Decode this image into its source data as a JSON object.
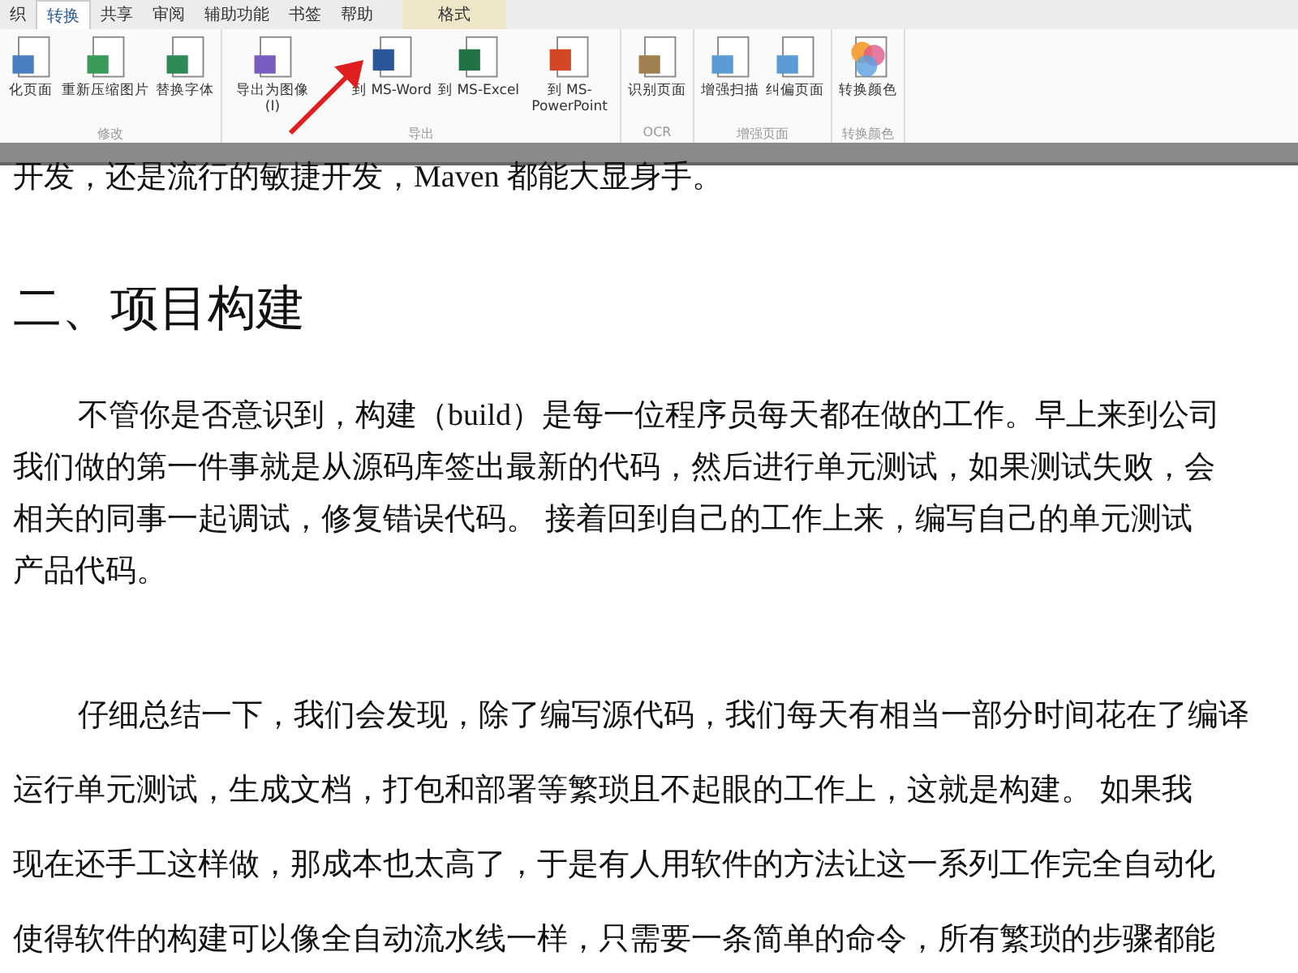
{
  "ribbon": {
    "tabs": [
      {
        "label": "织",
        "selected": false,
        "kind": "normal"
      },
      {
        "label": "转换",
        "selected": true,
        "kind": "normal"
      },
      {
        "label": "共享",
        "selected": false,
        "kind": "normal"
      },
      {
        "label": "审阅",
        "selected": false,
        "kind": "normal"
      },
      {
        "label": "辅助功能",
        "selected": false,
        "kind": "normal"
      },
      {
        "label": "书签",
        "selected": false,
        "kind": "normal"
      },
      {
        "label": "帮助",
        "selected": false,
        "kind": "normal"
      },
      {
        "label": "格式",
        "selected": false,
        "kind": "context"
      }
    ],
    "groups": [
      {
        "label": "修改",
        "commands": [
          {
            "label": "化页面",
            "kind": "optimize"
          },
          {
            "label": "重新压缩图片",
            "kind": "compress"
          },
          {
            "label": "替换字体",
            "kind": "font"
          }
        ]
      },
      {
        "label": "导出",
        "commands": [
          {
            "label": "导出为图像(I)",
            "kind": "image"
          },
          {
            "label": "到 MS-Word",
            "kind": "word"
          },
          {
            "label": "到 MS-Excel",
            "kind": "excel"
          },
          {
            "label": "到 MS-PowerPoint",
            "kind": "ppt"
          }
        ]
      },
      {
        "label": "OCR",
        "commands": [
          {
            "label": "识别页面",
            "kind": "ocr"
          }
        ]
      },
      {
        "label": "增强页面",
        "commands": [
          {
            "label": "增强扫描",
            "kind": "scan"
          },
          {
            "label": "纠偏页面",
            "kind": "deskew"
          }
        ]
      },
      {
        "label": "转换颜色",
        "commands": [
          {
            "label": "转换颜色",
            "kind": "color"
          }
        ]
      }
    ]
  },
  "document": {
    "blocks": [
      {
        "kind": "line",
        "text": "开发，还是流行的敏捷开发，Maven 都能大显身手。"
      },
      {
        "kind": "heading",
        "text": "二、项目构建"
      },
      {
        "kind": "para",
        "lines": [
          "不管你是否意识到，构建（build）是每一位程序员每天都在做的工作。早上来到公司",
          "我们做的第一件事就是从源码库签出最新的代码，然后进行单元测试，如果测试失败，会",
          "相关的同事一起调试，修复错误代码。 接着回到自己的工作上来，编写自己的单元测试",
          "产品代码。"
        ]
      },
      {
        "kind": "para_loose",
        "lines": [
          "仔细总结一下，我们会发现，除了编写源代码，我们每天有相当一部分时间花在了编译",
          "运行单元测试，生成文档，打包和部署等繁琐且不起眼的工作上，这就是构建。 如果我",
          "现在还手工这样做，那成本也太高了，于是有人用软件的方法让这一系列工作完全自动化",
          "使得软件的构建可以像全自动流水线一样，只需要一条简单的命令，所有繁琐的步骤都能"
        ]
      }
    ]
  }
}
